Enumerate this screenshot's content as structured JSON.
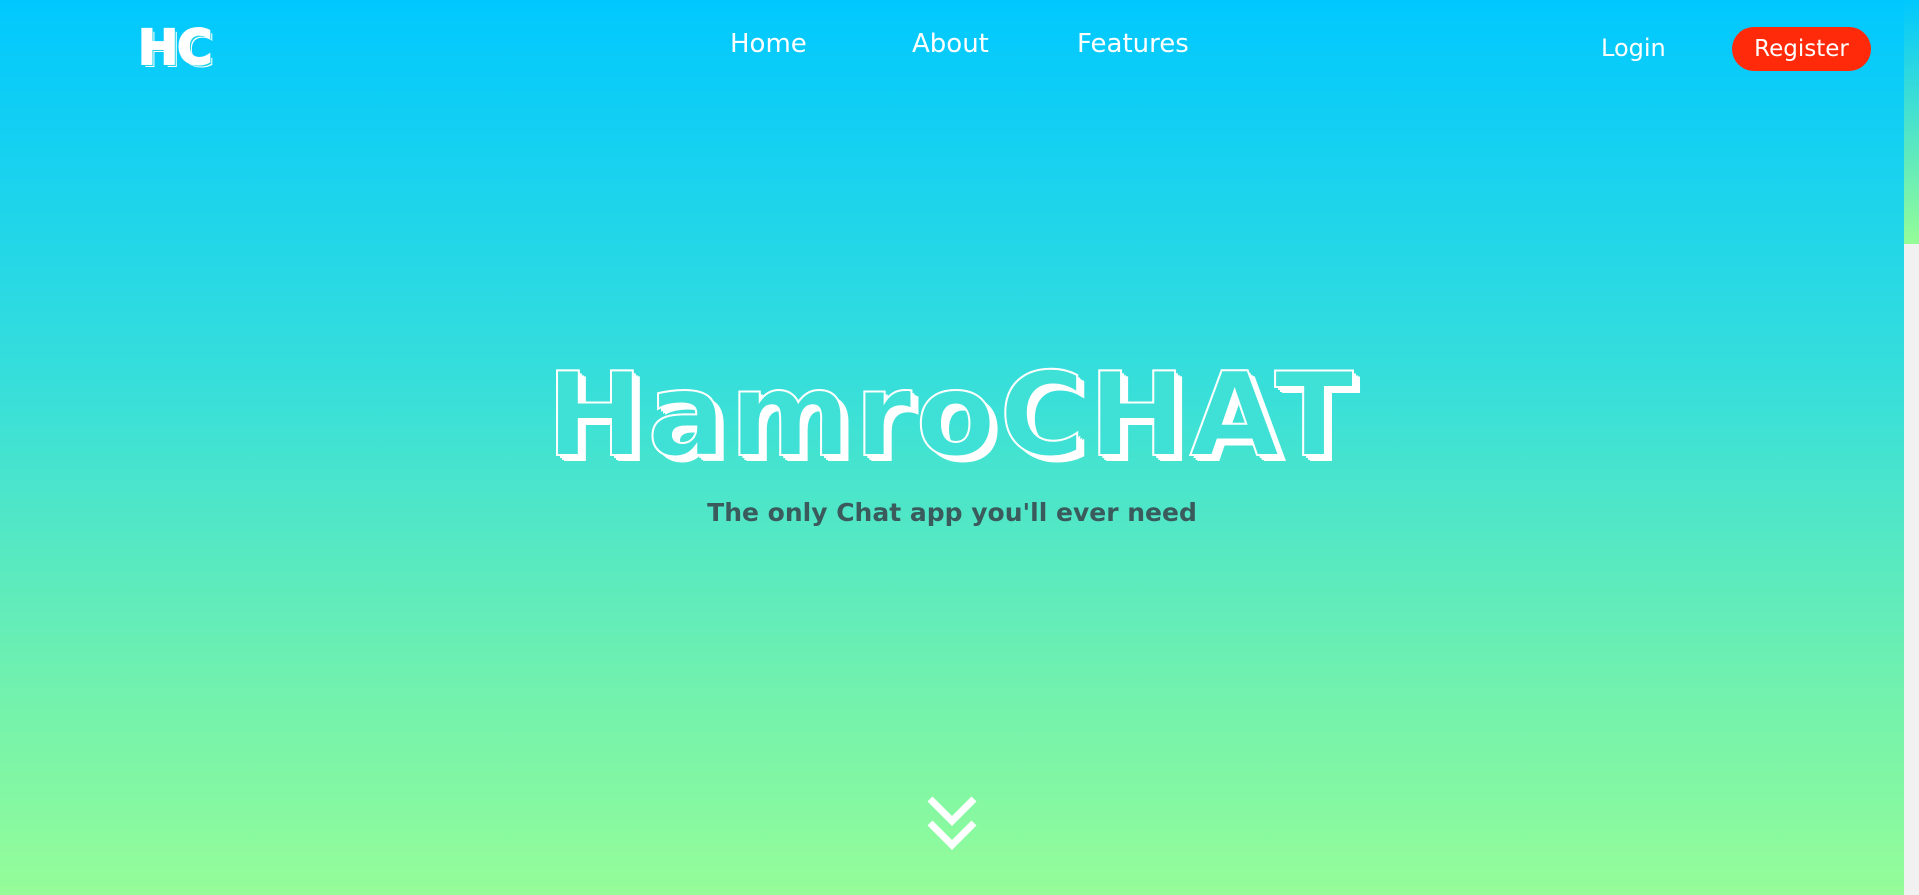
{
  "logo": {
    "text": "HC"
  },
  "nav": {
    "home": "Home",
    "about": "About",
    "features": "Features"
  },
  "auth": {
    "login": "Login",
    "register": "Register"
  },
  "hero": {
    "title": "HamroCHAT",
    "subtitle": "The only Chat app you'll ever need"
  },
  "icons": {
    "scroll_down": "double-chevron-down-icon"
  },
  "colors": {
    "gradient_top": "#00c8ff",
    "gradient_bottom": "#95fd98",
    "register_bg": "#ff2a0a",
    "subtitle_text": "#3a5a5c"
  }
}
